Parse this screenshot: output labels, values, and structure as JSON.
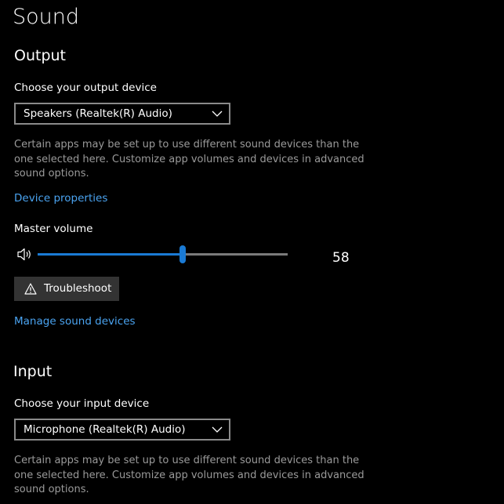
{
  "page": {
    "title": "Sound"
  },
  "output": {
    "heading": "Output",
    "device_label": "Choose your output device",
    "device_value": "Speakers (Realtek(R) Audio)",
    "help_text": "Certain apps may be set up to use different sound devices than the one selected here. Customize app volumes and devices in advanced sound options.",
    "device_properties_link": "Device properties",
    "volume_label": "Master volume",
    "volume_value": 58,
    "volume_icon": "speaker-icon",
    "troubleshoot_label": "Troubleshoot",
    "troubleshoot_icon": "warning-icon",
    "manage_link": "Manage sound devices"
  },
  "input": {
    "heading": "Input",
    "device_label": "Choose your input device",
    "device_value": "Microphone (Realtek(R) Audio)",
    "help_text": "Certain apps may be set up to use different sound devices than the one selected here. Customize app volumes and devices in advanced sound options."
  },
  "colors": {
    "background": "#000000",
    "text": "#ffffff",
    "secondary_text": "#9a9a9a",
    "link": "#4aa3f0",
    "accent": "#1a7ad4",
    "button": "#333333"
  }
}
